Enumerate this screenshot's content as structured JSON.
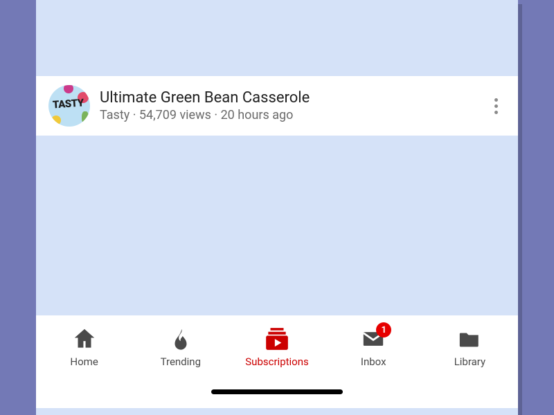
{
  "video": {
    "title": "Ultimate Green Bean Casserole",
    "channel": "Tasty",
    "views": "54,709 views",
    "age": "20 hours ago",
    "avatar_text": "TASTY"
  },
  "nav": {
    "home": {
      "label": "Home"
    },
    "trend": {
      "label": "Trending"
    },
    "subs": {
      "label": "Subscriptions"
    },
    "inbox": {
      "label": "Inbox",
      "badge": "1"
    },
    "library": {
      "label": "Library"
    }
  },
  "sep": " · "
}
